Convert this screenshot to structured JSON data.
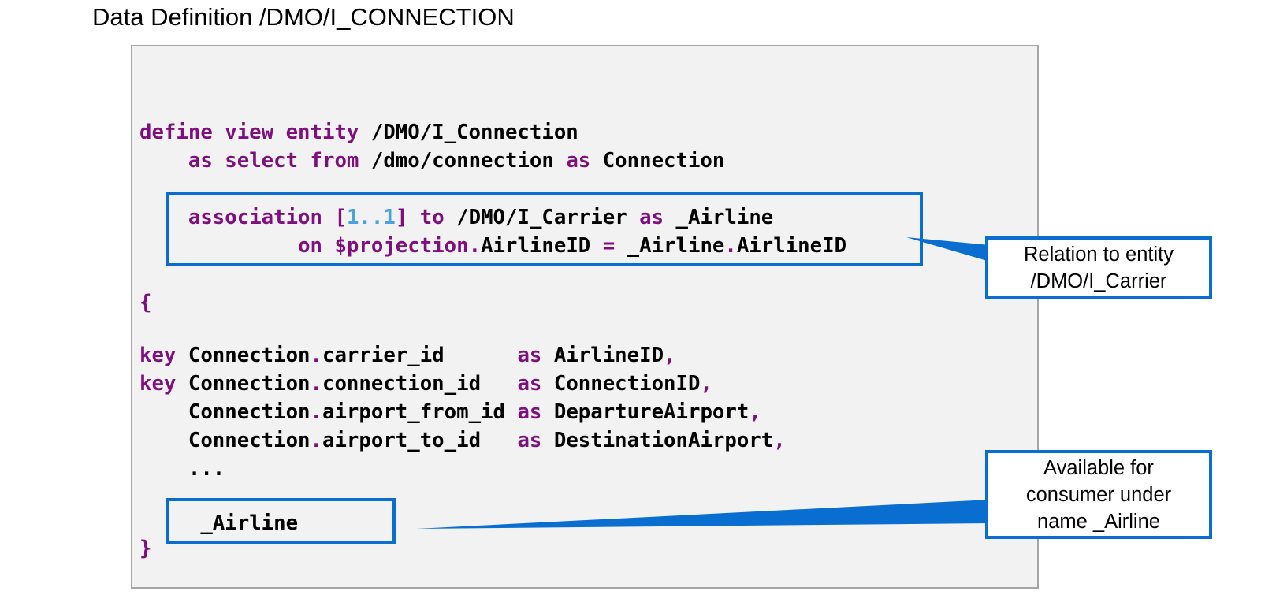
{
  "title": "Data Definition /DMO/I_CONNECTION",
  "code": {
    "line1": {
      "kw1": "define view entity",
      "name": " /DMO/I_Connection"
    },
    "line2": {
      "indent": "    ",
      "kw1": "as select from",
      "t1": " /dmo/connection ",
      "kw2": "as",
      "t2": " Connection"
    },
    "line3": {
      "indent": "    ",
      "kw1": "association",
      "t1": " ",
      "b1": "[",
      "n1": "1",
      "dd": "..",
      "n2": "1",
      "b2": "]",
      "t2": " ",
      "kw2": "to",
      "t3": " /DMO/I_Carrier ",
      "kw3": "as",
      "t4": " _Airline"
    },
    "line4": {
      "indent": "             ",
      "kw1": "on",
      "t1": " ",
      "kw2": "$projection",
      "d1": ".",
      "t2": "AirlineID ",
      "op": "=",
      "t3": " _Airline",
      "d2": ".",
      "t4": "AirlineID"
    },
    "line5": {
      "brace": "{"
    },
    "line6": {
      "kw": "key",
      "t1": " Connection",
      "d": ".",
      "t2": "carrier_id      ",
      "as": "as",
      "t3": " AirlineID",
      "c": ","
    },
    "line7": {
      "kw": "key",
      "t1": " Connection",
      "d": ".",
      "t2": "connection_id   ",
      "as": "as",
      "t3": " ConnectionID",
      "c": ","
    },
    "line8": {
      "indent": "    ",
      "t1": "Connection",
      "d": ".",
      "t2": "airport_from_id ",
      "as": "as",
      "t3": " DepartureAirport",
      "c": ","
    },
    "line9": {
      "indent": "    ",
      "t1": "Connection",
      "d": ".",
      "t2": "airport_to_id   ",
      "as": "as",
      "t3": " DestinationAirport",
      "c": ","
    },
    "line10": {
      "indent": "    ",
      "t1": "..."
    },
    "line11": {
      "indent": "     ",
      "t1": "_Airline"
    },
    "line12": {
      "brace": "}"
    }
  },
  "callouts": {
    "relation": "Relation to entity\n/DMO/I_Carrier",
    "available": "Available for\nconsumer under\nname _Airline"
  },
  "colors": {
    "keyword": "#7f0f7e",
    "number": "#4aa3df",
    "highlight": "#0a6ed1",
    "panel": "#f2f2f2"
  }
}
